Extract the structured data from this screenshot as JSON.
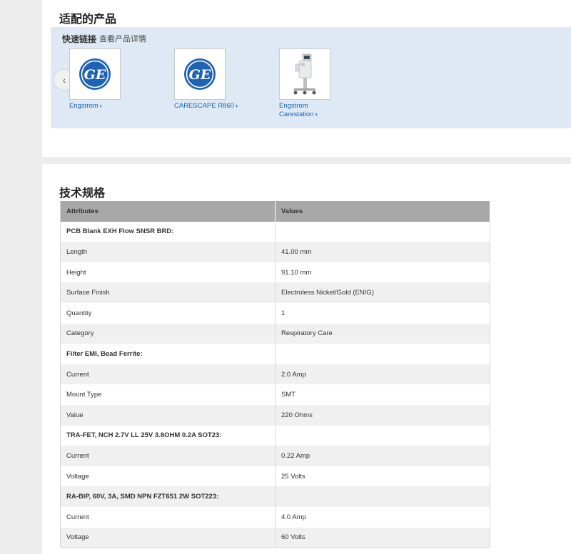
{
  "compatible": {
    "title": "适配的产品",
    "quick_links_label": "快速链接",
    "view_details": "查看产品详情",
    "prev_arrow": "‹",
    "products": [
      {
        "name": "Engstrom",
        "chevron": "›"
      },
      {
        "name": "CARESCAPE R860",
        "chevron": "›"
      },
      {
        "name_line1": "Engstrom",
        "name_line2": "Carestation",
        "chevron": "›"
      }
    ]
  },
  "specs": {
    "title": "技术规格",
    "columns": [
      "Attributes",
      "Values"
    ],
    "rows": [
      {
        "group": "PCB Blank EXH Flow SNSR BRD:"
      },
      {
        "attr": "Length",
        "value": "41.00 mm"
      },
      {
        "attr": "Height",
        "value": "91.10 mm"
      },
      {
        "attr": "Surface Finish",
        "value": "Electroless Nickel/Gold (ENIG)"
      },
      {
        "attr": "Quantity",
        "value": "1"
      },
      {
        "attr": "Category",
        "value": "Respiratory Care"
      },
      {
        "group": "Filter EMI, Bead Ferrite:"
      },
      {
        "attr": "Current",
        "value": "2.0 Amp"
      },
      {
        "attr": "Mount Type",
        "value": "SMT"
      },
      {
        "attr": "Value",
        "value": "220 Ohms"
      },
      {
        "group": "TRA-FET, NCH 2.7V LL 25V 3.8OHM 0.2A SOT23:"
      },
      {
        "attr": "Current",
        "value": "0.22 Amp"
      },
      {
        "attr": "Voltage",
        "value": "25 Volts"
      },
      {
        "group": "RA-BIP, 60V, 3A, SMD NPN FZT651 2W SOT223:"
      },
      {
        "attr": "Current",
        "value": "4.0 Amp"
      },
      {
        "attr": "Voltage",
        "value": "60 Volts"
      }
    ]
  },
  "colors": {
    "brand_blue": "#1f63b5",
    "link_blue": "#1565b7",
    "quicklink_bg": "#dfe9f5",
    "table_header_bg": "#a8a8a8"
  },
  "icons": [
    "ge-logo-icon",
    "ventilator-icon",
    "chevron-left-icon",
    "chevron-right-icon"
  ]
}
